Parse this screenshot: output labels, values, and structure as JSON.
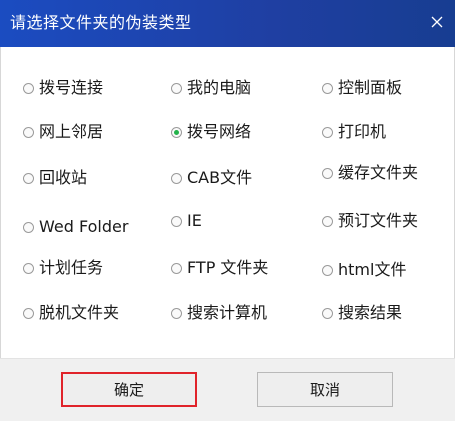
{
  "window": {
    "title": "请选择文件夹的伪装类型",
    "close_icon": "close-icon"
  },
  "options": [
    {
      "label": "拨号连接",
      "checked": false
    },
    {
      "label": "我的电脑",
      "checked": false
    },
    {
      "label": "控制面板",
      "checked": false
    },
    {
      "label": "网上邻居",
      "checked": false
    },
    {
      "label": "拨号网络",
      "checked": true
    },
    {
      "label": "打印机",
      "checked": false
    },
    {
      "label": "回收站",
      "checked": false
    },
    {
      "label": "CAB文件",
      "checked": false
    },
    {
      "label": "缓存文件夹",
      "checked": false
    },
    {
      "label": "Wed Folder",
      "checked": false
    },
    {
      "label": "IE",
      "checked": false
    },
    {
      "label": "预订文件夹",
      "checked": false
    },
    {
      "label": "计划任务",
      "checked": false
    },
    {
      "label": "FTP 文件夹",
      "checked": false
    },
    {
      "label": "html文件",
      "checked": false
    },
    {
      "label": "脱机文件夹",
      "checked": false
    },
    {
      "label": "搜索计算机",
      "checked": false
    },
    {
      "label": "搜索结果",
      "checked": false
    }
  ],
  "buttons": {
    "ok_label": "确定",
    "cancel_label": "取消"
  },
  "colors": {
    "titlebar": "#1f3fa2",
    "radio_selected": "#24b34b",
    "ok_highlight_border": "#e0232a"
  }
}
